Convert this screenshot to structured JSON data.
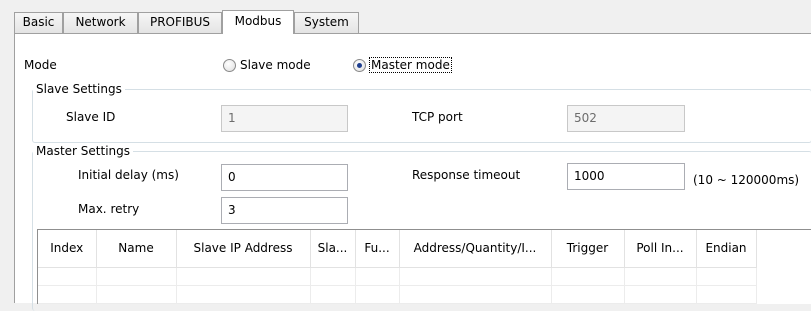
{
  "tabs": [
    "Basic",
    "Network",
    "PROFIBUS",
    "Modbus",
    "System"
  ],
  "active_tab": "Modbus",
  "mode": {
    "label": "Mode",
    "options": [
      "Slave mode",
      "Master mode"
    ],
    "selected": "Master mode"
  },
  "slave_settings": {
    "title": "Slave Settings",
    "slave_id_label": "Slave ID",
    "slave_id_value": "1",
    "tcp_port_label": "TCP port",
    "tcp_port_value": "502"
  },
  "master_settings": {
    "title": "Master Settings",
    "initial_delay_label": "Initial delay (ms)",
    "initial_delay_value": "0",
    "max_retry_label": "Max. retry",
    "max_retry_value": "3",
    "response_timeout_label": "Response timeout",
    "response_timeout_value": "1000",
    "response_timeout_range": "(10 ~ 120000ms)"
  },
  "table": {
    "columns": [
      "Index",
      "Name",
      "Slave IP Address",
      "Sla...",
      "Fu...",
      "Address/Quantity/I...",
      "Trigger",
      "Poll In...",
      "Endian"
    ],
    "rows": []
  },
  "colors": {
    "panel_bg": "#ffffff",
    "window_bg": "#f0f0f0",
    "group_border": "#d5dfe5",
    "radio_dot": "#1f3f8f"
  }
}
